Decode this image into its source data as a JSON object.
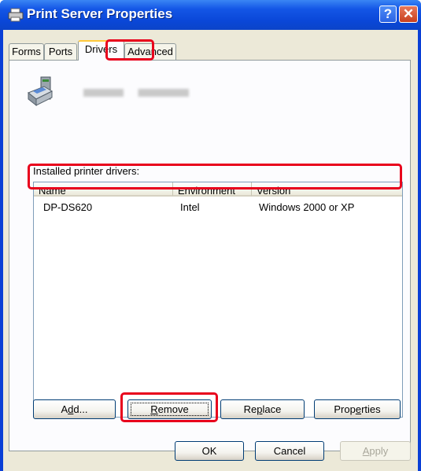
{
  "window": {
    "title": "Print Server Properties"
  },
  "tabs": [
    {
      "label": "Forms"
    },
    {
      "label": "Ports"
    },
    {
      "label": "Drivers"
    },
    {
      "label": "Advanced"
    }
  ],
  "installed_label": "Installed printer drivers:",
  "table": {
    "columns": [
      "Name",
      "Environment",
      "Version"
    ],
    "rows": [
      {
        "name": "DP-DS620",
        "environment": "Intel",
        "version": "Windows 2000 or XP"
      }
    ]
  },
  "buttons": {
    "add": {
      "pre": "A",
      "accel": "d",
      "post": "d..."
    },
    "remove": {
      "pre": "",
      "accel": "R",
      "post": "emove"
    },
    "replace": {
      "pre": "Re",
      "accel": "p",
      "post": "lace"
    },
    "properties": {
      "pre": "Prop",
      "accel": "e",
      "post": "rties"
    },
    "ok": "OK",
    "cancel": "Cancel",
    "apply": {
      "pre": "",
      "accel": "A",
      "post": "pply"
    }
  },
  "colors": {
    "titlebar": "#0a47d8",
    "highlight": "#e8001c",
    "dialog_bg": "#ece9d8"
  }
}
